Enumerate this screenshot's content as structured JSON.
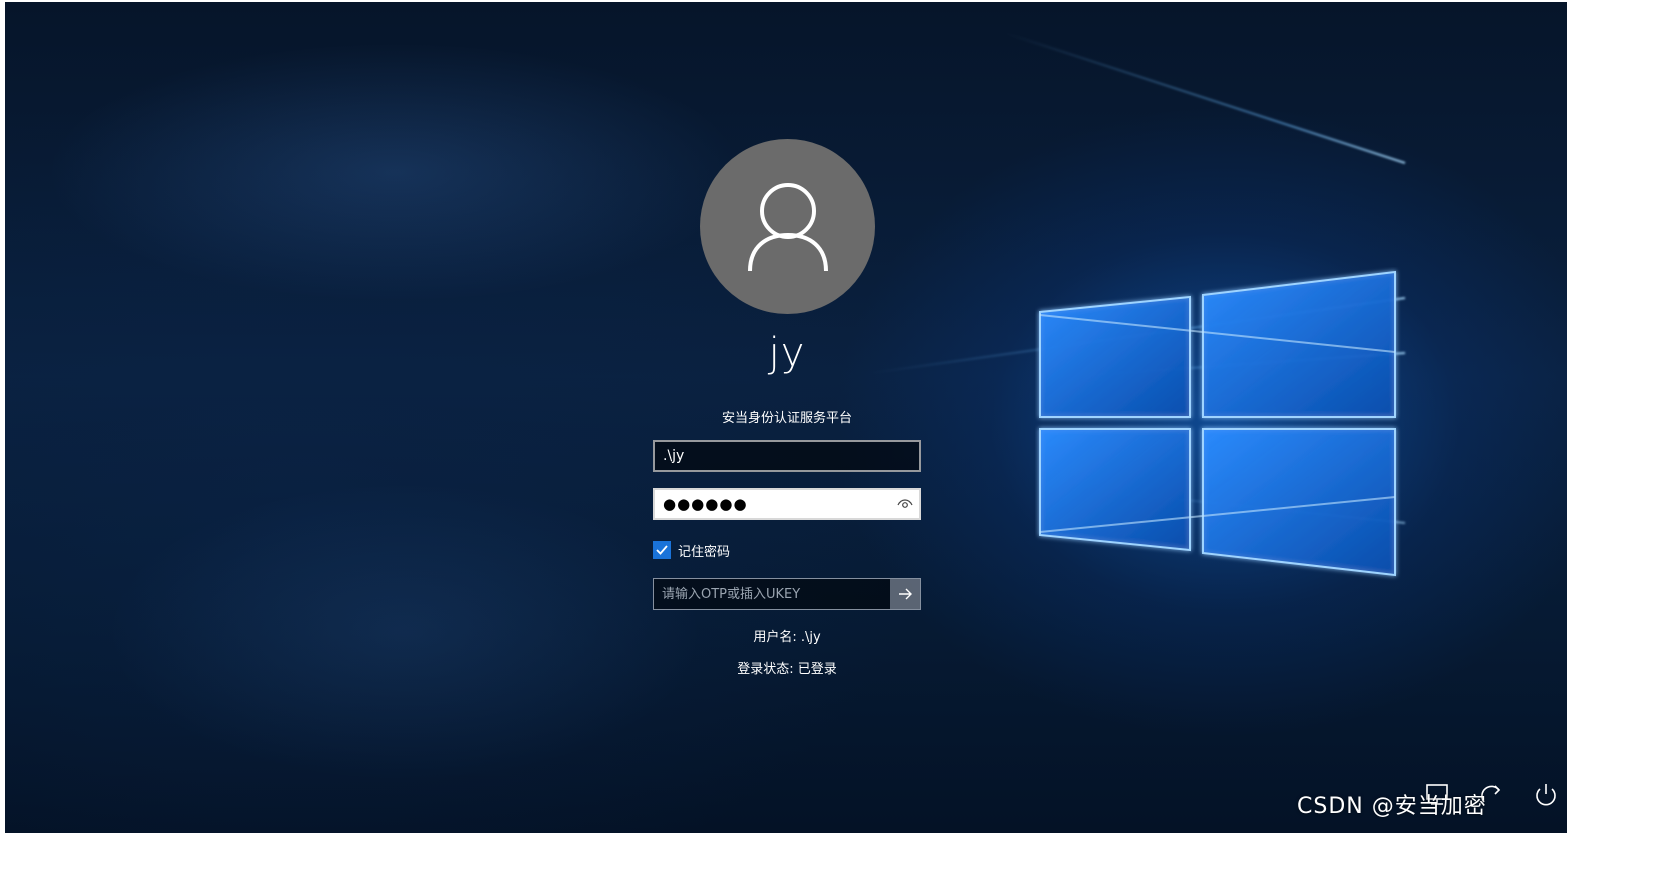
{
  "login": {
    "username_display": "jy",
    "platform_title": "安当身份认证服务平台",
    "username_field_value": ".\\jy",
    "password_mask": "●●●●●●",
    "remember_password_label": "记住密码",
    "remember_password_checked": true,
    "otp_placeholder": "请输入OTP或插入UKEY",
    "user_info": "用户名: .\\jy",
    "login_status": "登录状态: 已登录"
  },
  "icons": {
    "avatar": "user-icon",
    "reveal": "eye-icon",
    "submit": "arrow-right-icon",
    "network": "network-icon",
    "accessibility": "ease-of-access-icon",
    "power": "power-icon"
  },
  "watermark": "CSDN @安当加密",
  "colors": {
    "avatar_bg": "#6b6b6b",
    "checkbox_accent": "#1a73d9",
    "background": "#0a2140",
    "logo_glow": "#3aa0ff"
  }
}
